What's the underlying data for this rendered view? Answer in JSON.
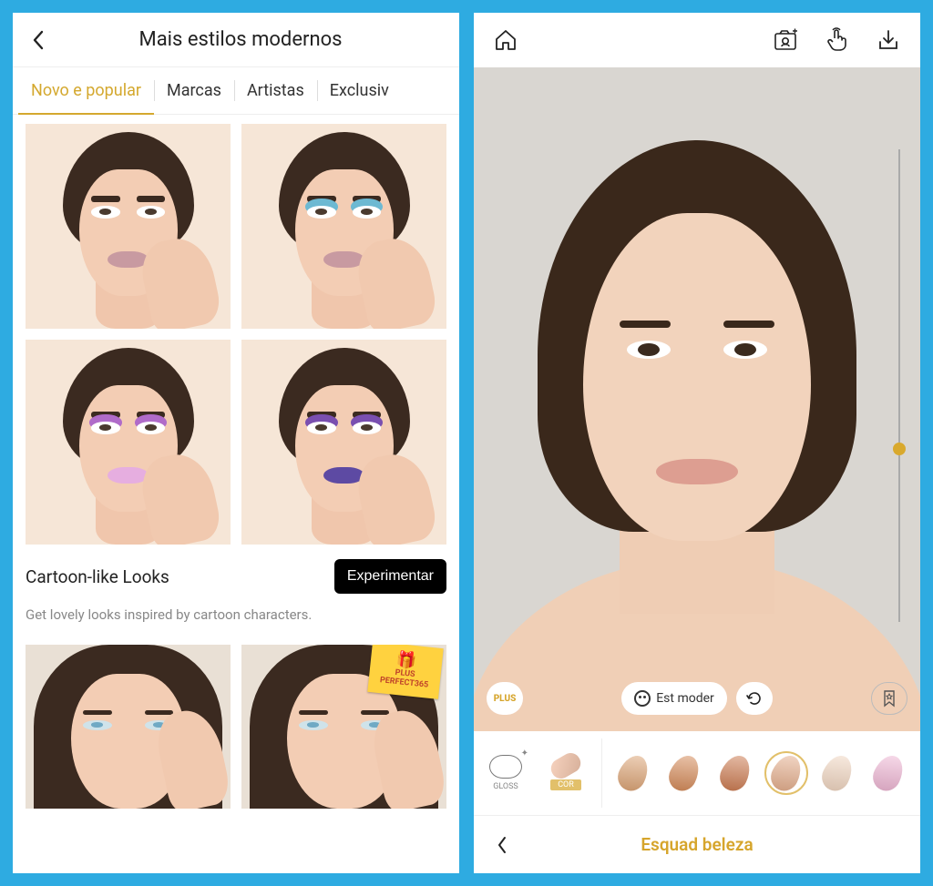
{
  "left": {
    "title": "Mais estilos modernos",
    "tabs": [
      "Novo e popular",
      "Marcas",
      "Artistas",
      "Exclusiv"
    ],
    "active_tab": 0,
    "looks_grid": [
      {
        "lip_color": "#c89aa1",
        "lid_color": "#3a2a20"
      },
      {
        "lip_color": "#c89aa1",
        "lid_color": "#6db9d2"
      },
      {
        "lip_color": "#e6aee0",
        "lid_color": "#b06bc9"
      },
      {
        "lip_color": "#5d4aa3",
        "lid_color": "#7a4fb0"
      }
    ],
    "section_title": "Cartoon-like Looks",
    "try_button": "Experimentar",
    "section_desc": "Get lovely looks inspired by cartoon characters.",
    "plus_badge_top": "PLUS",
    "plus_badge_bottom": "PERFECT365"
  },
  "right": {
    "plus_label": "PLUS",
    "est_moder_label": "Est moder",
    "gloss_label": "GLOSS",
    "cor_label": "COR",
    "swatches": [
      {
        "color": "#e0a574",
        "selected": false
      },
      {
        "color": "#d88a56",
        "selected": false
      },
      {
        "color": "#cf7a4e",
        "selected": false
      },
      {
        "color": "#e9b08d",
        "selected": true
      },
      {
        "color": "#f5d9c3",
        "selected": false
      },
      {
        "color": "#f3b8d7",
        "selected": false
      }
    ],
    "bottom_title": "Esquad beleza",
    "slider_value": 0.62
  }
}
